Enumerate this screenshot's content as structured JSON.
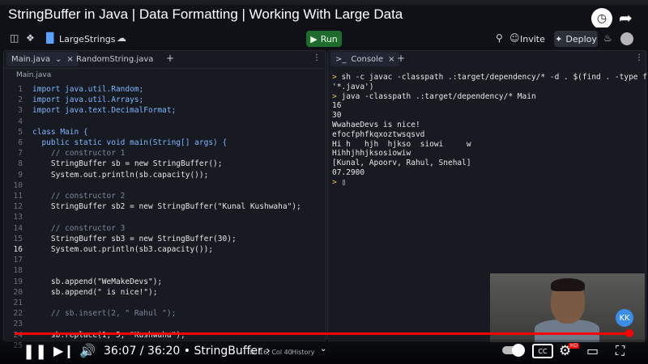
{
  "video": {
    "title": "StringBuffer in Java | Data Formatting | Working With Large Data",
    "current_time": "36:07",
    "duration": "36:20",
    "chapter": "• StringBuffer",
    "progress": 0.994
  },
  "header": {
    "project_name": "LargeStrings",
    "run_label": "Run",
    "invite_label": "Invite",
    "deploy_label": "Deploy"
  },
  "editor": {
    "tabs": [
      {
        "label": "Main.java"
      },
      {
        "label": "RandomString.java"
      }
    ],
    "breadcrumb": "Main.java",
    "lines": [
      {
        "n": "1",
        "text": "import java.util.Random;"
      },
      {
        "n": "2",
        "text": "import java.util.Arrays;"
      },
      {
        "n": "3",
        "text": "import java.text.DecimalFormat;"
      },
      {
        "n": "4",
        "text": ""
      },
      {
        "n": "5",
        "text": "class Main {"
      },
      {
        "n": "6",
        "text": "  public static void main(String[] args) {"
      },
      {
        "n": "7",
        "text": "    // constructor 1"
      },
      {
        "n": "8",
        "text": "    StringBuffer sb = new StringBuffer();"
      },
      {
        "n": "9",
        "text": "    System.out.println(sb.capacity());"
      },
      {
        "n": "10",
        "text": ""
      },
      {
        "n": "11",
        "text": "    // constructor 2"
      },
      {
        "n": "12",
        "text": "    StringBuffer sb2 = new StringBuffer(\"Kunal Kushwaha\");"
      },
      {
        "n": "13",
        "text": ""
      },
      {
        "n": "14",
        "text": "    // constructor 3"
      },
      {
        "n": "15",
        "text": "    StringBuffer sb3 = new StringBuffer(30);"
      },
      {
        "n": "16",
        "text": "    System.out.println(sb3.capacity());"
      },
      {
        "n": "17",
        "text": ""
      },
      {
        "n": "18",
        "text": ""
      },
      {
        "n": "19",
        "text": "    sb.append(\"WeMakeDevs\");"
      },
      {
        "n": "20",
        "text": "    sb.append(\" is nice!\");"
      },
      {
        "n": "21",
        "text": ""
      },
      {
        "n": "22",
        "text": "    // sb.insert(2, \" Rahul \");"
      },
      {
        "n": "23",
        "text": ""
      },
      {
        "n": "24",
        "text": "    sb.replace(1, 5, \"Kushwaha\");"
      },
      {
        "n": "25",
        "text": ""
      }
    ],
    "status": "Ln 16, Col 40",
    "history_label": "History"
  },
  "console": {
    "tab_label": "Console",
    "lines": [
      {
        "prompt": ">",
        "text": "sh -c javac -classpath .:target/dependency/* -d . $(find . -type f -name"
      },
      {
        "prompt": "",
        "text": "'*.java')"
      },
      {
        "prompt": ">",
        "text": "java -classpath .:target/dependency/* Main"
      },
      {
        "prompt": "",
        "text": "16"
      },
      {
        "prompt": "",
        "text": "30"
      },
      {
        "prompt": "",
        "text": "WwahaeDevs is nice!"
      },
      {
        "prompt": "",
        "text": "efocfphfkqxoztwsqsvd"
      },
      {
        "prompt": "",
        "text": "Hi h   hjh  hjkso  siowi     w"
      },
      {
        "prompt": "",
        "text": "Hihhjhhjksosiowiw"
      },
      {
        "prompt": "",
        "text": "[Kunal, Apoorv, Rahul, Snehal]"
      },
      {
        "prompt": "",
        "text": "07.2900"
      },
      {
        "prompt": ">",
        "text": "▯"
      }
    ]
  },
  "webcam": {
    "logo_text": "KK"
  },
  "controls": {
    "cc_label": "CC",
    "hd_label": "HD"
  },
  "colors": {
    "run_green": "#1f6b2e",
    "progress_red": "#ff0000",
    "keyword_blue": "#7eb6ff",
    "string_orange": "#f0b36b",
    "prompt_yellow": "#f0c453"
  }
}
